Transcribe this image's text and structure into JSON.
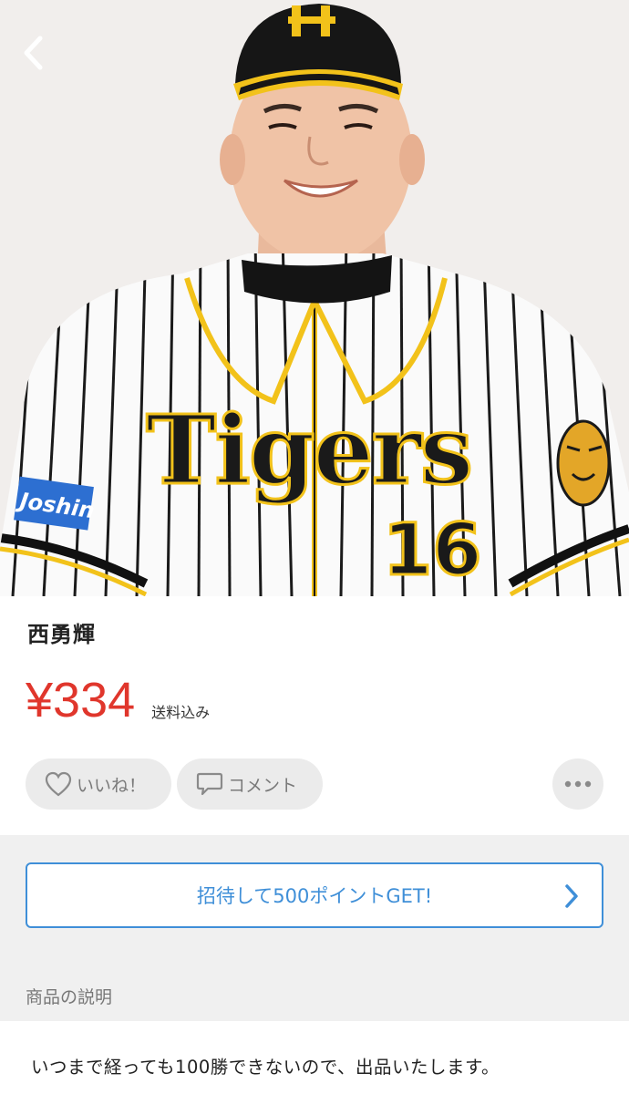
{
  "product": {
    "title": "西勇輝",
    "price": "¥334",
    "shipping": "送料込み"
  },
  "photo": {
    "jersey_text": "Tigers",
    "number": "16",
    "sleeve_patch": "Joshin",
    "colors": {
      "stripe": "#1a1a1a",
      "gold": "#f2c21a",
      "jersey": "#fafafa",
      "patch": "#2d6fd1"
    }
  },
  "actions": {
    "like_label": "いいね！",
    "comment_label": "コメント",
    "like_icon": "heart-outline-icon",
    "comment_icon": "speech-bubble-icon",
    "more_icon": "more-dots-icon"
  },
  "invite": {
    "label": "招待して500ポイントGET!",
    "accent": "#3f8fd8"
  },
  "description": {
    "heading": "商品の説明",
    "body": "いつまで経っても100勝できないので、出品いたします。"
  },
  "colors": {
    "price": "#e0362c",
    "pill_bg": "#ebebeb",
    "section_bg": "#f0f0f0"
  }
}
